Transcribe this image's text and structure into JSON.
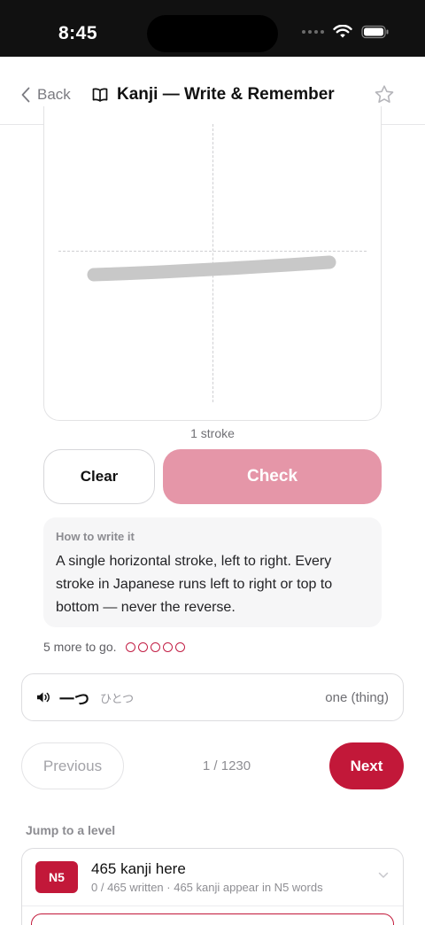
{
  "status": {
    "time": "8:45"
  },
  "nav": {
    "back_label": "Back",
    "title": "Kanji — Write & Remember"
  },
  "practice": {
    "stroke_count": "1 stroke",
    "clear_label": "Clear",
    "check_label": "Check",
    "hint_label": "How to write it",
    "hint_text": "A single horizontal stroke, left to right. Every stroke in Japanese runs left to right or top to bottom — never the reverse.",
    "progress_text": "5 more to go.",
    "progress_dots_remaining": 5
  },
  "word": {
    "kanji": "一つ",
    "kana": "ひとつ",
    "meaning": "one (thing)"
  },
  "pager": {
    "prev_label": "Previous",
    "position": "1 / 1230",
    "next_label": "Next"
  },
  "levels": {
    "heading": "Jump to a level",
    "items": [
      {
        "badge": "N5",
        "title": "465 kanji here",
        "subtitle": "0 / 465 written · 465 kanji appear in N5 words"
      }
    ]
  },
  "colors": {
    "accent": "#c21839",
    "check_disabled": "#e596a8"
  }
}
